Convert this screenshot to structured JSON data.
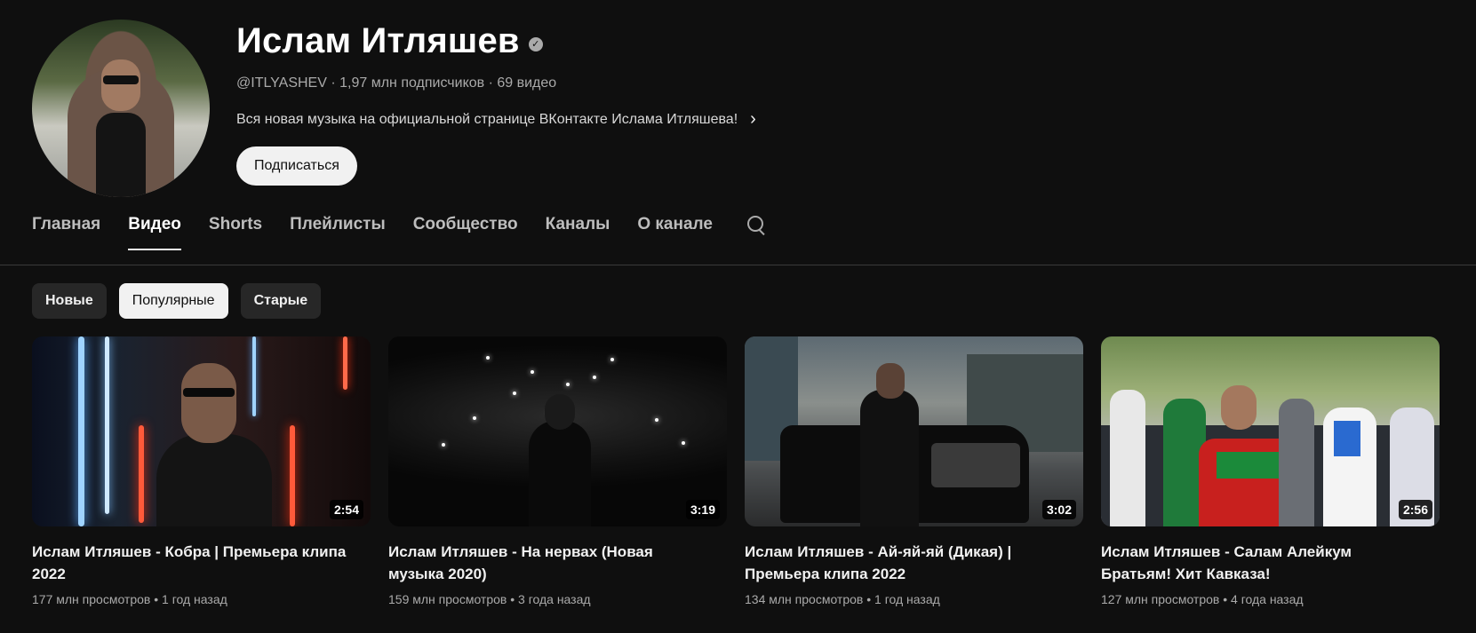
{
  "channel": {
    "name": "Ислам Итляшев",
    "verified_icon": "check-icon",
    "meta": "@ITLYASHEV · 1,97 млн подписчиков · 69 видео",
    "description": "Вся новая музыка на официальной странице ВКонтакте Ислама Итляшева!",
    "subscribe_label": "Подписаться"
  },
  "tabs": [
    {
      "label": "Главная",
      "active": false
    },
    {
      "label": "Видео",
      "active": true
    },
    {
      "label": "Shorts",
      "active": false
    },
    {
      "label": "Плейлисты",
      "active": false
    },
    {
      "label": "Сообщество",
      "active": false
    },
    {
      "label": "Каналы",
      "active": false
    },
    {
      "label": "О канале",
      "active": false
    }
  ],
  "chips": [
    {
      "label": "Новые",
      "selected": false
    },
    {
      "label": "Популярные",
      "selected": true
    },
    {
      "label": "Старые",
      "selected": false
    }
  ],
  "videos": [
    {
      "title": "Ислам Итляшев - Кобра | Премьера клипа 2022",
      "duration": "2:54",
      "meta": "177 млн просмотров • 1 год назад"
    },
    {
      "title": "Ислам Итляшев - На нервах (Новая музыка 2020)",
      "duration": "3:19",
      "meta": "159 млн просмотров • 3 года назад"
    },
    {
      "title": "Ислам Итляшев - Ай-яй-яй (Дикая) | Премьера клипа 2022",
      "duration": "3:02",
      "meta": "134 млн просмотров • 1 год назад"
    },
    {
      "title": "Ислам Итляшев - Салам Алейкум Братьям! Хит Кавказа!",
      "duration": "2:56",
      "meta": "127 млн просмотров • 4 года назад"
    }
  ],
  "colors": {
    "background": "#0f0f0f",
    "chip": "#272727",
    "chip_selected": "#f1f1f1",
    "text_secondary": "#aaaaaa"
  }
}
